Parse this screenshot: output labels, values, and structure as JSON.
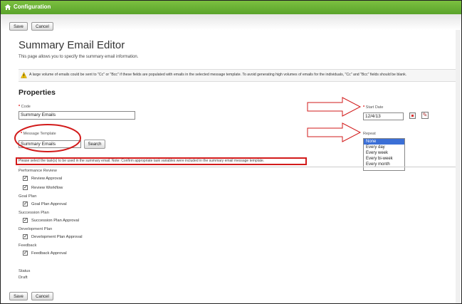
{
  "header": {
    "title": "Configuration"
  },
  "toolbar": {
    "save_label": "Save",
    "cancel_label": "Cancel"
  },
  "page": {
    "title": "Summary Email Editor",
    "subtitle": "This page allows you to specify the summary email information."
  },
  "warning": "A large volume of emails could be sent to \"Cc\" or \"Bcc\" if these fields are populated with emails in the selected message template. To avoid generating high volumes of emails for the individuals, \"Cc\" and \"Bcc\" fields should be blank.",
  "properties": {
    "heading": "Properties",
    "code_label": "Code",
    "code_value": "Summary Emails",
    "template_label": "Message Template",
    "template_value": "Summary Emails",
    "search_label": "Search",
    "start_date_label": "Start Date",
    "start_date_value": "12/4/13",
    "repeat_label": "Repeat",
    "repeat_options": [
      "None",
      "Every day",
      "Every week",
      "Every bi-week",
      "Every month"
    ],
    "repeat_selected": "None"
  },
  "tasks_notice": "Please select the task(s) to be used in the summary email. Note: Confirm appropriate task variables were included in the summary email message template.",
  "groups": [
    {
      "name": "Performance Review",
      "tasks": [
        "Review Approval",
        "Review Workflow"
      ]
    },
    {
      "name": "Goal Plan",
      "tasks": [
        "Goal Plan Approval"
      ]
    },
    {
      "name": "Succession Plan",
      "tasks": [
        "Succession Plan Approval"
      ]
    },
    {
      "name": "Development Plan",
      "tasks": [
        "Development Plan Approval"
      ]
    },
    {
      "name": "Feedback",
      "tasks": [
        "Feedback Approval"
      ]
    }
  ],
  "status": {
    "label": "Status",
    "value": "Draft"
  },
  "colors": {
    "header_green": "#5aa32b",
    "annotation_red": "#d21b1b",
    "selected_blue": "#3b6fd6"
  },
  "icons": [
    "home-icon",
    "warning-icon",
    "calendar-icon",
    "edit-icon",
    "checkbox-checked-icon"
  ]
}
